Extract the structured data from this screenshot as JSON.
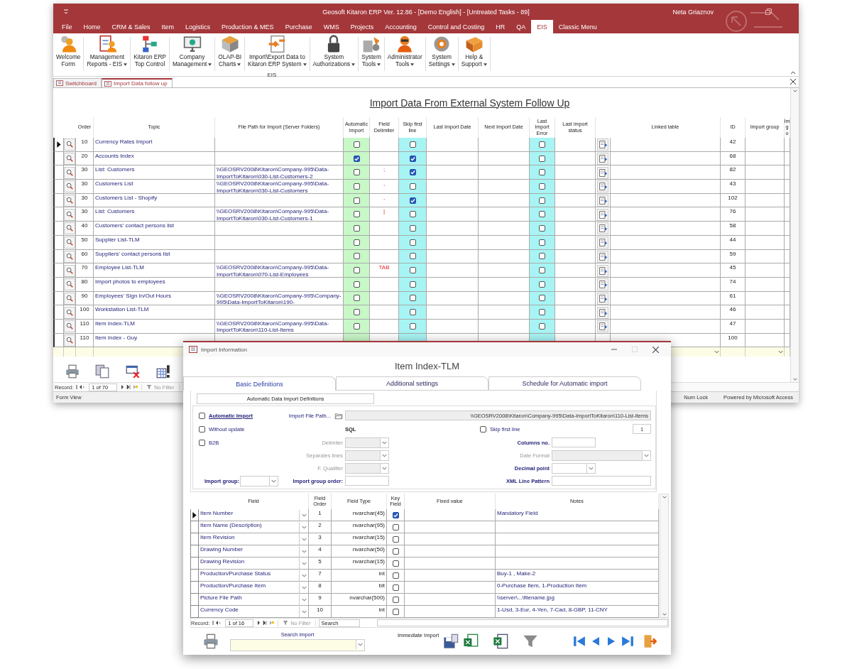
{
  "window": {
    "title": "Geosoft Kitaron ERP Ver. 12.86 - [Demo English] - [Untreated Tasks - 89]",
    "user": "Neta Griaznov"
  },
  "menu_tabs": [
    {
      "label": "File",
      "selected": false
    },
    {
      "label": "Home",
      "selected": false
    },
    {
      "label": "CRM & Sales",
      "selected": false
    },
    {
      "label": "Item",
      "selected": false
    },
    {
      "label": "Logistics",
      "selected": false
    },
    {
      "label": "Production & MES",
      "selected": false
    },
    {
      "label": "Purchase",
      "selected": false
    },
    {
      "label": "WMS",
      "selected": false
    },
    {
      "label": "Projects",
      "selected": false
    },
    {
      "label": "Accounting",
      "selected": false
    },
    {
      "label": "Control and Costing",
      "selected": false
    },
    {
      "label": "HR",
      "selected": false
    },
    {
      "label": "QA",
      "selected": false
    },
    {
      "label": "EIS",
      "selected": true
    },
    {
      "label": "Classic Menu",
      "selected": false
    }
  ],
  "ribbon": {
    "group_label": "EIS",
    "buttons": [
      {
        "label": "Welcome\nForm",
        "dropdown": false
      },
      {
        "label": "Management\nReports - EIS",
        "dropdown": true
      },
      {
        "label": "Kitaron ERP\nTop Control",
        "dropdown": false
      },
      {
        "label": "Company\nManagement",
        "dropdown": true
      },
      {
        "label": "OLAP-BI\nCharts",
        "dropdown": true
      },
      {
        "label": "Import\\Export Data to\nKitaron ERP System",
        "dropdown": true
      },
      {
        "label": "System\nAuthorizations",
        "dropdown": true
      },
      {
        "label": "System\nTools",
        "dropdown": true
      },
      {
        "label": "Administrator\nTools",
        "dropdown": true
      },
      {
        "label": "System\nSettings",
        "dropdown": true
      },
      {
        "label": "Help &\nSupport",
        "dropdown": true
      }
    ]
  },
  "doc_tabs": [
    {
      "label": "Switchboard",
      "selected": false
    },
    {
      "label": "Import Data follow up",
      "selected": true
    }
  ],
  "form": {
    "title": "Import Data From External System Follow Up",
    "columns": [
      "Order",
      "Topic",
      "File Path for Import (Server Folders)",
      "Automatic Import",
      "Field Delimiter",
      "Skip first line",
      "Last Import Date",
      "Next Import Date",
      "Last Import Error",
      "Last import status",
      "Linked table",
      "ID",
      "Import group",
      "Im\ng\no"
    ],
    "rows": [
      {
        "kind": "full",
        "current": true,
        "order": "10",
        "topic": "Currency Rates Import",
        "path": "",
        "auto_import": false,
        "delimiter": "",
        "skip_first": false,
        "import_error": false,
        "id": "42"
      },
      {
        "kind": "full",
        "current": false,
        "order": "20",
        "topic": "Accounts Index",
        "path": "",
        "auto_import": true,
        "delimiter": "",
        "skip_first": true,
        "import_error": false,
        "id": "68"
      },
      {
        "kind": "full",
        "current": false,
        "order": "30",
        "topic": "List: Customers",
        "path": "\\\\GEOSRV2008\\Kitaron\\Company-995\\Data-ImportToKitaron\\030-List-Customers-2",
        "auto_import": false,
        "delimiter": ";",
        "skip_first": true,
        "import_error": false,
        "id": "82"
      },
      {
        "kind": "full",
        "current": false,
        "order": "30",
        "topic": "Customers List",
        "path": "\\\\GEOSRV2008\\Kitaron\\Company-995\\Data-ImportToKitaron\\030-List-Customers",
        "auto_import": false,
        "delimiter": ",",
        "skip_first": false,
        "import_error": false,
        "id": "43"
      },
      {
        "kind": "full",
        "current": false,
        "order": "30",
        "topic": "Customers List - Shopify",
        "path": "",
        "auto_import": false,
        "delimiter": ",",
        "skip_first": true,
        "import_error": false,
        "id": "102"
      },
      {
        "kind": "full",
        "current": false,
        "order": "30",
        "topic": "List: Customers",
        "path": "\\\\GEOSRV2008\\Kitaron\\Company-995\\Data-ImportToKitaron\\030-List-Customers-1",
        "auto_import": false,
        "delimiter": "|",
        "skip_first": false,
        "import_error": false,
        "id": "76"
      },
      {
        "kind": "full",
        "current": false,
        "order": "40",
        "topic": "Customers' contact persons list",
        "path": "",
        "auto_import": false,
        "delimiter": "",
        "skip_first": false,
        "import_error": false,
        "id": "58"
      },
      {
        "kind": "full",
        "current": false,
        "order": "50",
        "topic": "Supplier List-TLM",
        "path": "",
        "auto_import": false,
        "delimiter": "",
        "skip_first": false,
        "import_error": false,
        "id": "44"
      },
      {
        "kind": "full",
        "current": false,
        "order": "60",
        "topic": "Suppliers' contact persons list",
        "path": "",
        "auto_import": false,
        "delimiter": "",
        "skip_first": false,
        "import_error": false,
        "id": "59"
      },
      {
        "kind": "full",
        "current": false,
        "order": "70",
        "topic": "Employee List-TLM",
        "path": "\\\\GEOSRV2008\\Kitaron\\Company-995\\Data-ImportToKitaron\\070-List-Employees",
        "auto_import": false,
        "delimiter": "TAB",
        "skip_first": false,
        "import_error": false,
        "id": "45"
      },
      {
        "kind": "full",
        "current": false,
        "order": "80",
        "topic": "Import photos to employees",
        "path": "",
        "auto_import": false,
        "delimiter": "",
        "skip_first": false,
        "import_error": false,
        "id": "74"
      },
      {
        "kind": "full",
        "current": false,
        "order": "90",
        "topic": "Employees' Sign In/Out Hours",
        "path": "\\\\GEOSRV2008\\Kitaron\\Company-995\\Company-995\\Data-ImportToKitaron\\190-",
        "auto_import": false,
        "delimiter": "",
        "skip_first": false,
        "import_error": false,
        "id": "61"
      },
      {
        "kind": "full",
        "current": false,
        "order": "100",
        "topic": "Workstation List-TLM",
        "path": "",
        "auto_import": false,
        "delimiter": "",
        "skip_first": false,
        "import_error": false,
        "id": "46"
      },
      {
        "kind": "full",
        "current": false,
        "order": "110",
        "topic": "Item Index-TLM",
        "path": "\\\\GEOSRV2008\\Kitaron\\Company-995\\Data-ImportToKitaron\\110-List-Items",
        "auto_import": false,
        "delimiter": "",
        "skip_first": false,
        "import_error": false,
        "id": "47"
      },
      {
        "kind": "partial",
        "current": false,
        "order": "110",
        "topic": "Item Index - Guy",
        "id": "100"
      }
    ],
    "navigation": {
      "label": "Record:",
      "position": "1 of 70",
      "filter": "No Filter"
    }
  },
  "status_bar": {
    "view": "Form View",
    "num_lock": "Num Lock",
    "powered_by": "Powered by Microsoft Access"
  },
  "dialog": {
    "title": "Import Information",
    "heading": "Item Index-TLM",
    "tabs": [
      {
        "label": "Basic Definitions",
        "selected": true
      },
      {
        "label": "Additional settings",
        "selected": false
      },
      {
        "label": "Schedule for Automatic import",
        "selected": false
      }
    ],
    "section_label": "Automatic Data Import Definitions",
    "automatic_import": {
      "label": "Automatic Import",
      "checked": false
    },
    "file_path": {
      "label": "Import File Path...",
      "value": "\\\\GEOSRV2008\\Kitaron\\Company-995\\Data-ImportToKitaron\\110-List-Items"
    },
    "without_update": {
      "label": "Without update",
      "checked": false
    },
    "sql_label": "SQL",
    "skip_first_line": {
      "label": "Skip first line",
      "checked": false,
      "value": "1"
    },
    "b2b": {
      "label": "B2B",
      "checked": false
    },
    "delimiter": {
      "label": "Delimiter",
      "disabled": true
    },
    "separates_lines": {
      "label": "Separates lines",
      "disabled": true
    },
    "f_qualifier": {
      "label": "F. Qualifier",
      "disabled": true
    },
    "columns_no": {
      "label": "Columns no."
    },
    "date_format": {
      "label": "Date Format",
      "disabled": true
    },
    "decimal_point": {
      "label": "Decimal point",
      "disabled": false
    },
    "import_group": {
      "label": "Import group:"
    },
    "import_group_order": {
      "label": "Import group order:"
    },
    "xml_line_pattern": {
      "label": "XML Line Pattern"
    },
    "grid": {
      "columns": [
        "Field",
        "Field Order",
        "Field Type",
        "Key Field",
        "Fixed value",
        "Notes"
      ],
      "rows": [
        {
          "current": true,
          "field": "Item Number",
          "order": "1",
          "type": "nvarchar(45)",
          "key": true,
          "notes": "Mandatory Field"
        },
        {
          "current": false,
          "field": "Item Name (Description)",
          "order": "2",
          "type": "nvarchar(95)",
          "key": false,
          "notes": ""
        },
        {
          "current": false,
          "field": "Item Revision",
          "order": "3",
          "type": "nvarchar(15)",
          "key": false,
          "notes": ""
        },
        {
          "current": false,
          "field": "Drawing Number",
          "order": "4",
          "type": "nvarchar(50)",
          "key": false,
          "notes": ""
        },
        {
          "current": false,
          "field": "Drawing Revision",
          "order": "5",
          "type": "nvarchar(15)",
          "key": false,
          "notes": ""
        },
        {
          "current": false,
          "field": "Production/Purchase Status",
          "order": "7",
          "type": "int",
          "key": false,
          "notes": "Buy-1 , Make-2"
        },
        {
          "current": false,
          "field": "Production/Purchase Item",
          "order": "8",
          "type": "bit",
          "key": false,
          "notes": "0-Purchase Item, 1-Production Item"
        },
        {
          "current": false,
          "field": "Picture File Path",
          "order": "9",
          "type": "nvarchar(500)",
          "key": false,
          "notes": "\\\\server\\...\\filename.jpg"
        },
        {
          "current": false,
          "field": "Currency Code",
          "order": "10",
          "type": "int",
          "key": false,
          "notes": "1-Usd, 3-Eur, 4-Yen, 7-Cad, 8-GBP, 11-CNY"
        }
      ],
      "navigation": {
        "label": "Record:",
        "position": "1 of 16",
        "filter": "No Filter",
        "search": "Search"
      }
    },
    "search_import_label": "Search import",
    "immediate_import_label": "Immediate Import"
  }
}
